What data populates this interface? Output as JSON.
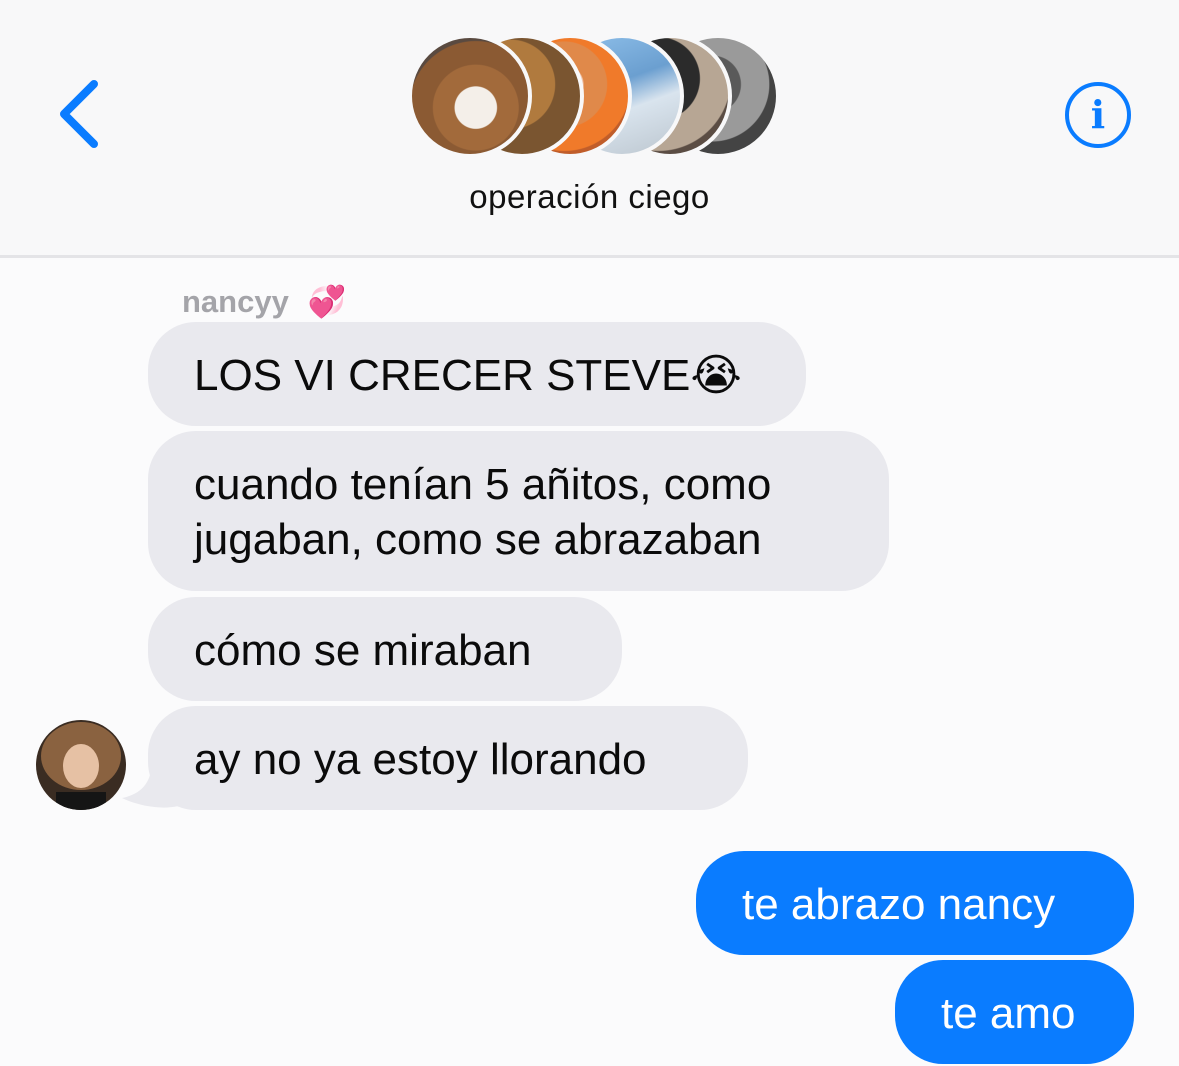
{
  "header": {
    "group_name": "operación ciego",
    "back_icon": "chevron-left-icon",
    "info_icon": "info-icon",
    "info_glyph": "i",
    "member_count": 6
  },
  "messages": {
    "sender": "nancyy",
    "sender_emoji": "💞",
    "received": [
      {
        "text": "LOS VI CRECER STEVE😭"
      },
      {
        "line1": "cuando tenían 5 añitos, como",
        "line2": "jugaban, como se abrazaban"
      },
      {
        "text": "cómo se miraban"
      },
      {
        "text": "ay no ya estoy llorando"
      }
    ],
    "sent": [
      {
        "text": "te abrazo nancy"
      },
      {
        "text": "te amo"
      }
    ]
  },
  "colors": {
    "accent": "#0a7cff",
    "received_bubble": "#e9e9ee",
    "header_bg": "#f8f8f9"
  }
}
